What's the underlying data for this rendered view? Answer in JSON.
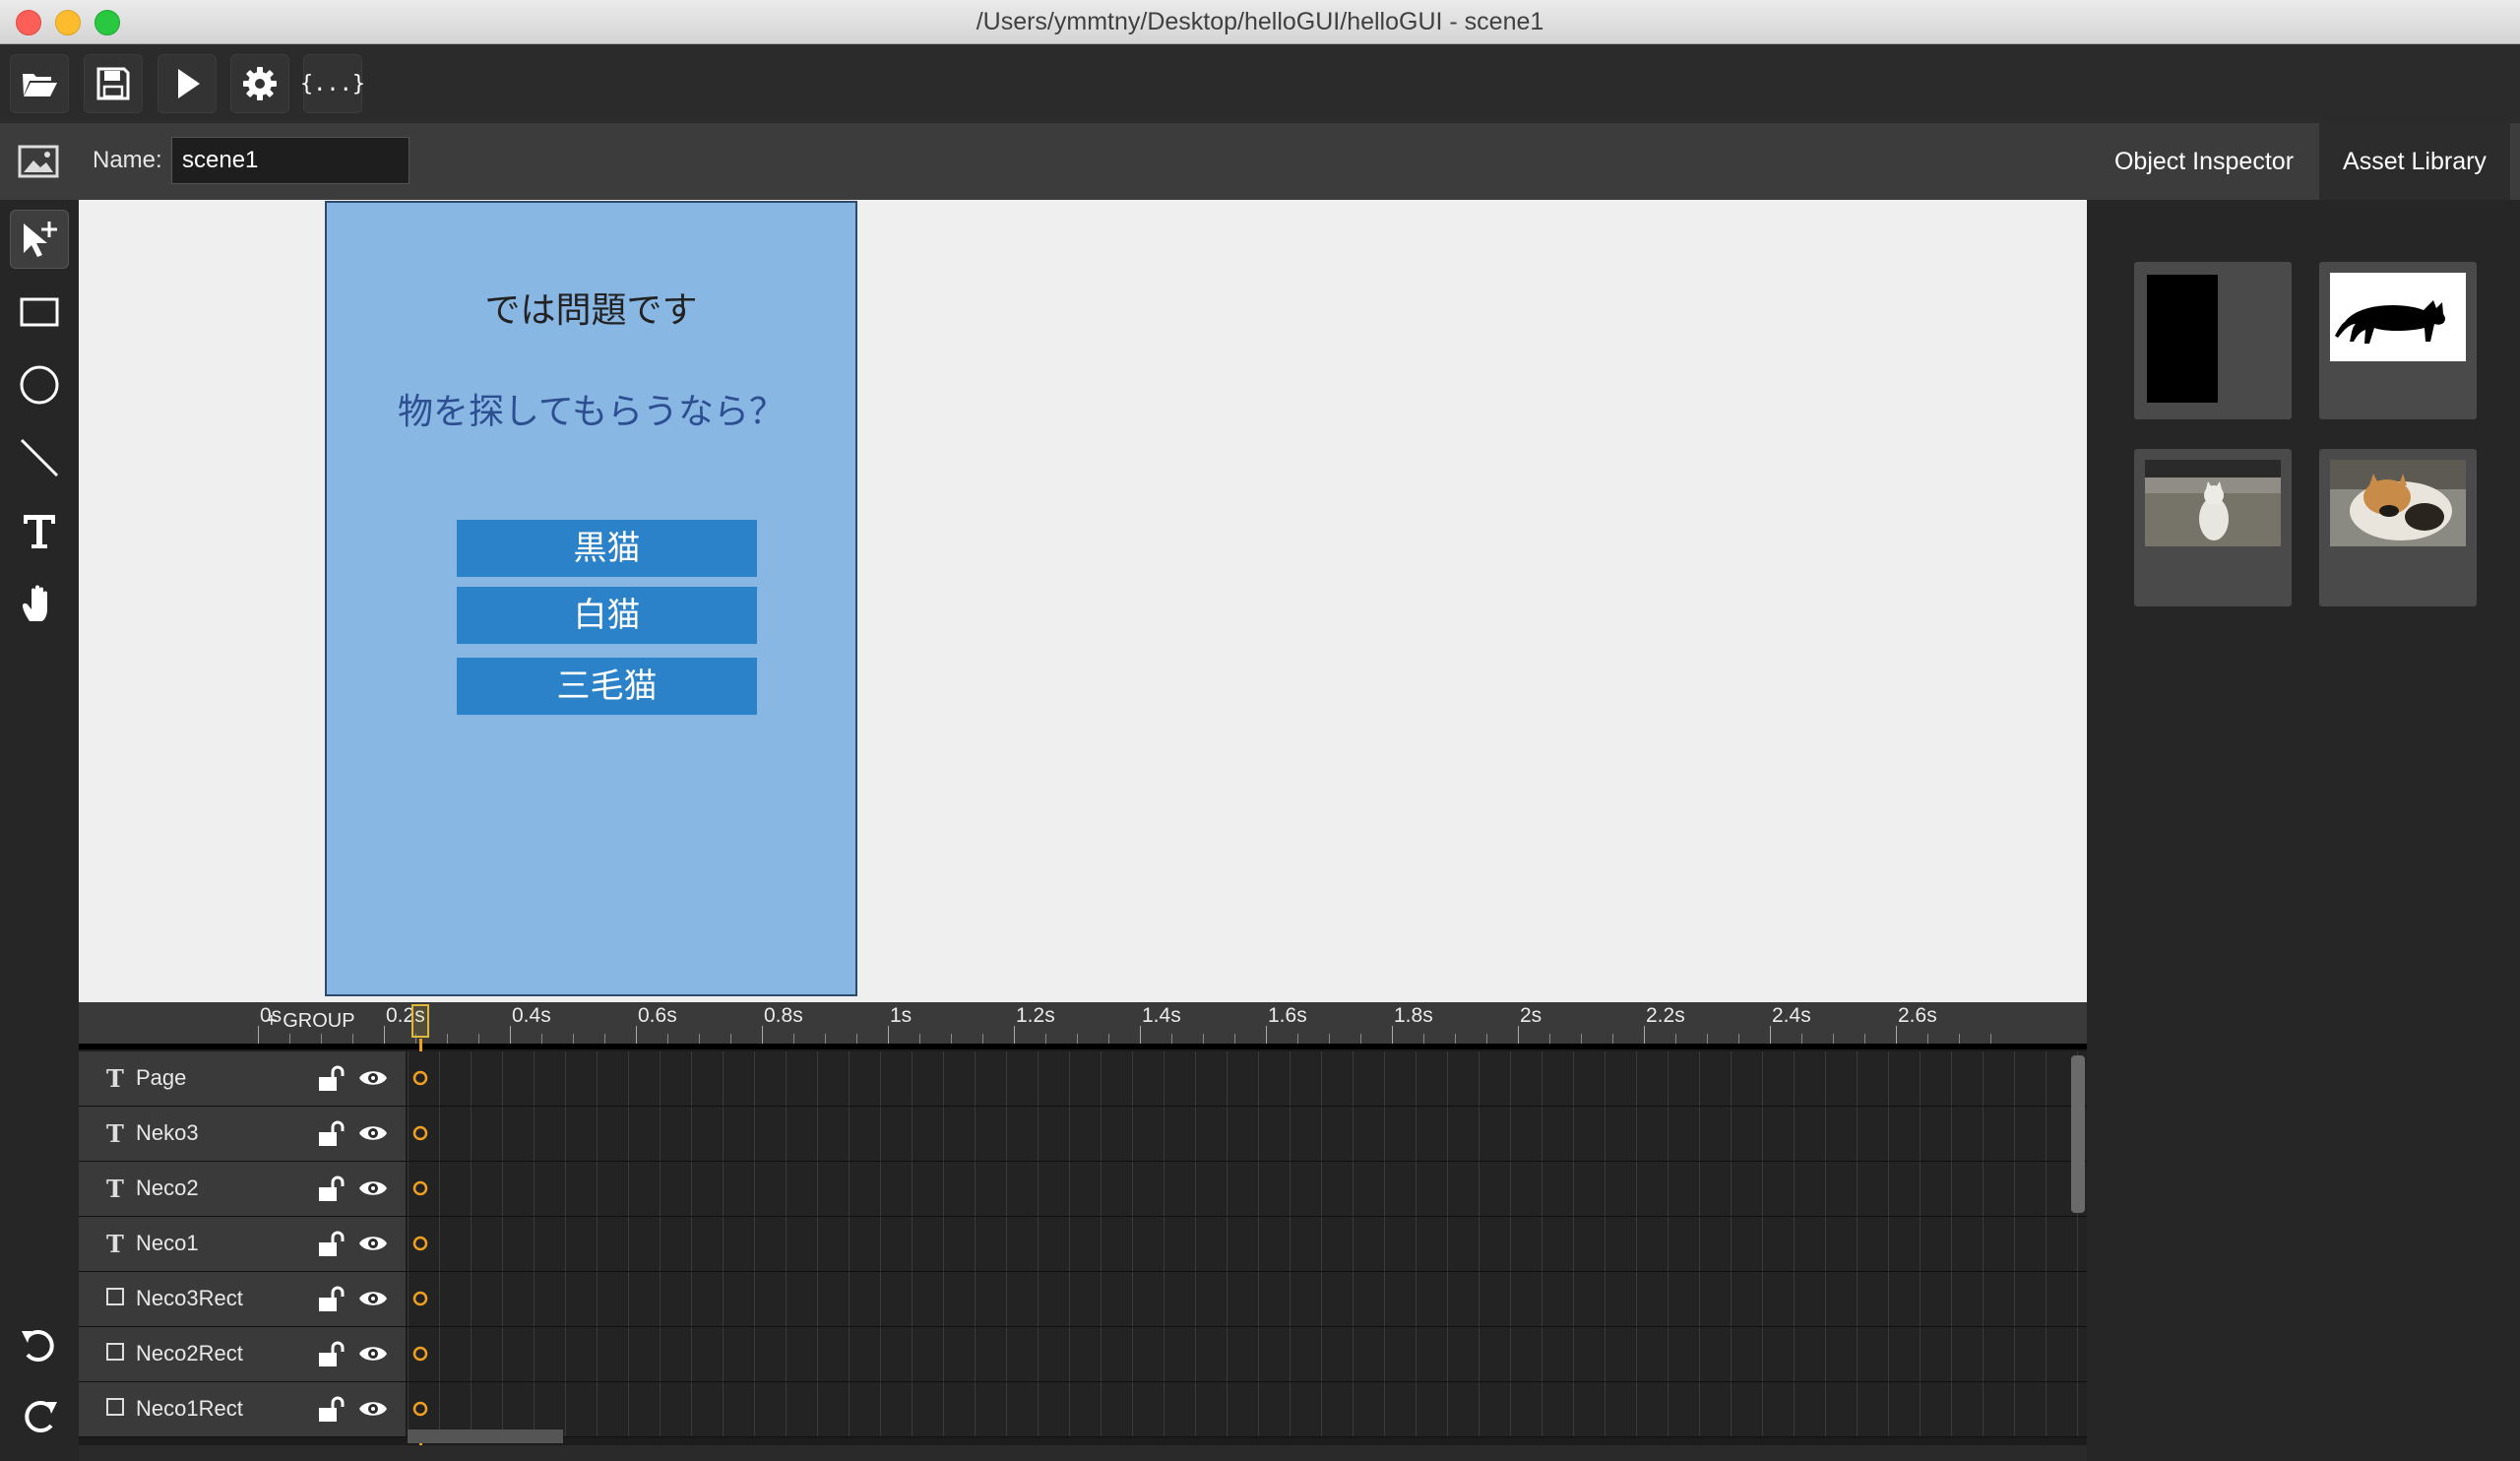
{
  "window": {
    "title": "/Users/ymmtny/Desktop/helloGUI/helloGUI - scene1"
  },
  "toolbar": {
    "buttons": [
      {
        "icon": "open-folder-icon"
      },
      {
        "icon": "save-icon"
      },
      {
        "icon": "play-icon"
      },
      {
        "icon": "settings-gear-icon"
      },
      {
        "icon": "code-braces-icon",
        "label": "{...}"
      }
    ]
  },
  "scene": {
    "name_label": "Name:",
    "name_value": "scene1"
  },
  "right_tabs": {
    "inspector": "Object Inspector",
    "assets": "Asset Library",
    "active": "assets"
  },
  "page": {
    "question_line1": "では問題です",
    "question_line2": "物を探してもらうなら？",
    "choices": [
      "黒猫",
      "白猫",
      "三毛猫"
    ],
    "bg_color": "#89b7e3",
    "button_color": "#2b82c8"
  },
  "assets": [
    {
      "name": "black-rect-thumbnail"
    },
    {
      "name": "black-cat-thumbnail"
    },
    {
      "name": "white-cat-photo-thumbnail"
    },
    {
      "name": "calico-cat-photo-thumbnail"
    }
  ],
  "timeline": {
    "add_group_label": "+ GROUP",
    "ticks": [
      "0s",
      "0.2s",
      "0.4s",
      "0.6s",
      "0.8s",
      "1s",
      "1.2s",
      "1.4s",
      "1.6s",
      "1.8s",
      "2s",
      "2.2s",
      "2.4s",
      "2.6s"
    ],
    "layers": [
      {
        "type": "text",
        "type_symbol": "T",
        "name": "Page"
      },
      {
        "type": "text",
        "type_symbol": "T",
        "name": "Neko3"
      },
      {
        "type": "text",
        "type_symbol": "T",
        "name": "Neco2"
      },
      {
        "type": "text",
        "type_symbol": "T",
        "name": "Neco1"
      },
      {
        "type": "rect",
        "type_symbol": "",
        "name": "Neco3Rect"
      },
      {
        "type": "rect",
        "type_symbol": "",
        "name": "Neco2Rect"
      },
      {
        "type": "rect",
        "type_symbol": "",
        "name": "Neco1Rect"
      }
    ],
    "playhead_time": "0s",
    "accent_color": "#f0a020"
  }
}
